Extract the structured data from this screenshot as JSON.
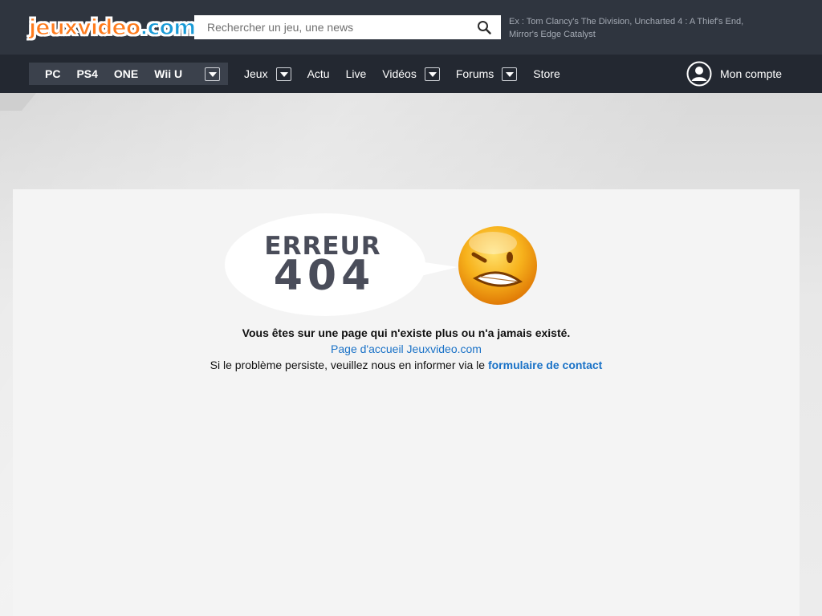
{
  "header": {
    "logo_part1": "jeux",
    "logo_part2": "video",
    "logo_part3": ".com",
    "search_placeholder": "Rechercher un jeu, une news",
    "search_hint": "Ex : Tom Clancy's The Division, Uncharted 4 : A Thief's End, Mirror's Edge Catalyst"
  },
  "nav": {
    "platforms": [
      "PC",
      "PS4",
      "ONE",
      "Wii U"
    ],
    "menu": {
      "jeux": "Jeux",
      "actu": "Actu",
      "live": "Live",
      "videos": "Vidéos",
      "forums": "Forums",
      "store": "Store"
    },
    "account_label": "Mon compte"
  },
  "error": {
    "title_line1": "ERREUR",
    "title_line2": "404",
    "message": "Vous êtes sur une page qui n'existe plus ou n'a jamais existé.",
    "home_link": "Page d'accueil Jeuxvideo.com",
    "persist_text": "Si le problème persiste, veuillez nous en informer via le ",
    "contact_link": "formulaire de contact"
  },
  "colors": {
    "header_bg": "#2f353f",
    "nav_bg": "#232831",
    "platform_bg": "#3b414c",
    "link": "#1a72c7",
    "logo_orange": "#ff7b1c",
    "logo_blue": "#1a9bd7"
  },
  "icons": {
    "search": "magnifier-icon",
    "account": "user-circle-icon",
    "dropdown": "caret-down-icon",
    "smiley": "scared-smiley-icon"
  }
}
